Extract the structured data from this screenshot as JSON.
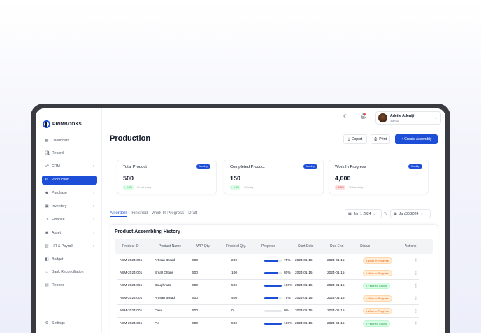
{
  "sidebar": {
    "brand": "PRIMBOOKS",
    "items": [
      {
        "label": "Dashboard",
        "icon": "grid-icon",
        "chevron": false,
        "active": false
      },
      {
        "label": "Record",
        "icon": "users-icon",
        "chevron": false,
        "active": false
      },
      {
        "label": "CRM",
        "icon": "crm-icon",
        "chevron": true,
        "active": false
      },
      {
        "label": "Production",
        "icon": "production-icon",
        "chevron": false,
        "active": true
      },
      {
        "label": "Purchase",
        "icon": "tag-icon",
        "chevron": true,
        "active": false
      },
      {
        "label": "Inventory",
        "icon": "box-icon",
        "chevron": true,
        "active": false
      },
      {
        "label": "Finance",
        "icon": "finance-icon",
        "chevron": true,
        "active": false
      },
      {
        "label": "Asset",
        "icon": "asset-icon",
        "chevron": true,
        "active": false
      },
      {
        "label": "HR & Payroll",
        "icon": "hr-icon",
        "chevron": true,
        "active": false
      },
      {
        "label": "Budget",
        "icon": "budget-icon",
        "chevron": false,
        "active": false
      },
      {
        "label": "Bank Reconciliation",
        "icon": "bank-icon",
        "chevron": false,
        "active": false
      },
      {
        "label": "Reports",
        "icon": "report-icon",
        "chevron": false,
        "active": false
      }
    ],
    "settings_label": "Settings"
  },
  "topbar": {
    "user_name": "Adeife Adeniji",
    "user_role": "Admin"
  },
  "page": {
    "title": "Production",
    "export_label": "Export",
    "print_label": "Print",
    "create_label": "+ Create Assembly"
  },
  "cards": [
    {
      "label": "Total Product",
      "pill": "Monthly",
      "value": "500",
      "delta": "↑ 0.3%",
      "delta_dir": "up",
      "note": "+11 last today"
    },
    {
      "label": "Completed Product",
      "pill": "Monthly",
      "value": "150",
      "delta": "↑ 0.3%",
      "delta_dir": "up",
      "note": "+11 today"
    },
    {
      "label": "Work In Progress",
      "pill": "Monthly",
      "value": "4,000",
      "delta": "↓ 0.3%",
      "delta_dir": "down",
      "note": "+11 last today"
    }
  ],
  "tabs": [
    "All orders",
    "Finished",
    "Work In Progress",
    "Draft"
  ],
  "date_range": {
    "from": "Jan 1 2024",
    "to_label": "To",
    "to": "Jan 30 2024"
  },
  "history": {
    "title": "Product Assembling History",
    "columns": [
      "Product ID",
      "Product Name",
      "WIP Qty.",
      "Finished Qty.",
      "Progress",
      "Start Date",
      "Due End",
      "Status",
      "Actions"
    ],
    "rows": [
      {
        "id": "ASM-2024-001",
        "name": "Artisan Bread",
        "wip": "500",
        "finished": "200",
        "progress": 75,
        "progress_label": "75%",
        "start": "2024-01-15",
        "due": "2024-01-15",
        "status": "• Work In Progress",
        "status_type": "wip"
      },
      {
        "id": "ASM-2024-001",
        "name": "Small Chops",
        "wip": "500",
        "finished": "100",
        "progress": 80,
        "progress_label": "80%",
        "start": "2024-01-15",
        "due": "2024-01-15",
        "status": "• Work In Progress",
        "status_type": "wip"
      },
      {
        "id": "ASM-2024-001",
        "name": "Doughnuts",
        "wip": "500",
        "finished": "500",
        "progress": 100,
        "progress_label": "100%",
        "start": "2024-01-15",
        "due": "2024-01-15",
        "status": "• Finished Goods",
        "status_type": "fin"
      },
      {
        "id": "ASM-2024-001",
        "name": "Artisan Bread",
        "wip": "500",
        "finished": "400",
        "progress": 75,
        "progress_label": "75%",
        "start": "2024-01-15",
        "due": "2024-01-15",
        "status": "• Work In Progress",
        "status_type": "wip"
      },
      {
        "id": "ASM-2024-001",
        "name": "Cake",
        "wip": "500",
        "finished": "0",
        "progress": 0,
        "progress_label": "0%",
        "start": "2024-01-15",
        "due": "2024-01-15",
        "status": "• Work In Progress",
        "status_type": "wip"
      },
      {
        "id": "ASM-2024-001",
        "name": "Pie",
        "wip": "500",
        "finished": "500",
        "progress": 100,
        "progress_label": "100%",
        "start": "2024-01-15",
        "due": "2024-01-15",
        "status": "• Finished Goods",
        "status_type": "fin"
      }
    ]
  },
  "colors": {
    "accent": "#1d4ed8",
    "wip": "#ea580c",
    "finished": "#16a34a"
  }
}
